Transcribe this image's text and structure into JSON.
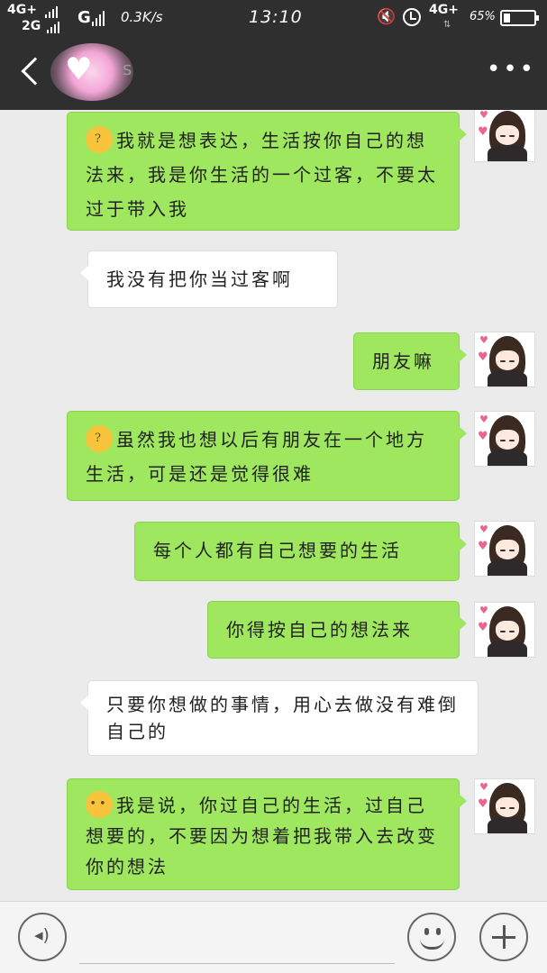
{
  "status_bar": {
    "network1": "4G+",
    "network2": "2G",
    "network_g": "G",
    "speed": "0.3K/s",
    "time": "13:10",
    "network3": "4G+",
    "battery": "65%"
  },
  "nav": {
    "more": "⋮"
  },
  "messages": [
    {
      "side": "right",
      "emoji": "thinking-face",
      "text": "我就是想表达，生活按你自己的想法来，我是你生活的一个过客，不要太过于带入我"
    },
    {
      "side": "left",
      "text": "我没有把你当过客啊"
    },
    {
      "side": "right",
      "text": "朋友嘛"
    },
    {
      "side": "right",
      "emoji": "thinking-face",
      "text": "虽然我也想以后有朋友在一个地方生活，可是还是觉得很难"
    },
    {
      "side": "right",
      "text": "每个人都有自己想要的生活"
    },
    {
      "side": "right",
      "text": "你得按自己的想法来"
    },
    {
      "side": "left",
      "text": "只要你想做的事情，用心去做没有难倒自己的"
    },
    {
      "side": "right",
      "emoji": "eye-roll-face",
      "text": "我是说，你过自己的生活，过自己想要的，不要因为想着把我带入去改变你的想法"
    }
  ],
  "colors": {
    "bar": "#2f2f2f",
    "background": "#ebebeb",
    "sent_bubble": "#9ee75f",
    "received_bubble": "#ffffff"
  }
}
